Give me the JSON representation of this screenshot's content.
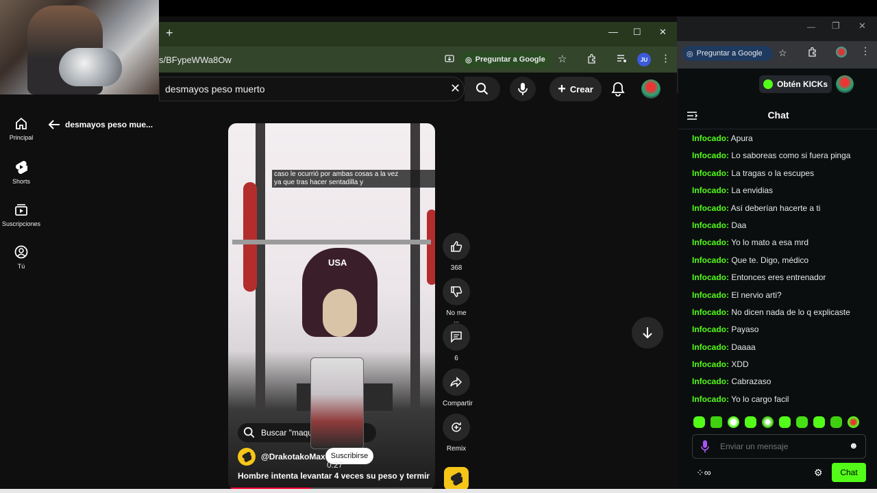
{
  "browser": {
    "new_tab": "+",
    "url": "s/BFypeWWa8Ow",
    "ask_google": "Preguntar a Google",
    "profile_initials": "JU",
    "bg_ask_google": "Preguntar a Google"
  },
  "youtube": {
    "search_value": "desmayos peso muerto",
    "create_label": "Crear",
    "back_title": "desmayos peso mue...",
    "sidebar": [
      {
        "label": "Principal",
        "icon": "home-icon"
      },
      {
        "label": "Shorts",
        "icon": "shorts-icon"
      },
      {
        "label": "Suscripciones",
        "icon": "subscriptions-icon"
      },
      {
        "label": "Tú",
        "icon": "you-icon"
      }
    ],
    "short": {
      "caption_line1": "caso le ocurrió por ambas cosas a la vez",
      "caption_line2": "ya que tras hacer sentadilla y",
      "jersey_text": "USA",
      "search_chip": "Buscar \"maqu",
      "channel": "@DrakotakoMax",
      "subscribe": "Suscribirse",
      "time": "0:27",
      "title": "Hombre intenta levantar 4 veces su peso y termina..."
    },
    "actions": {
      "likes": "368",
      "dislike": "No me ...",
      "comments": "6",
      "share": "Compartir",
      "remix": "Remix"
    }
  },
  "kick": {
    "get_kicks": "Obtén KICKs",
    "chat_title": "Chat",
    "username": "Infocado:",
    "messages": [
      "Apura",
      "Lo saboreas como si fuera pinga",
      "La tragas o la escupes",
      "La envidias",
      "Así deberían hacerte a ti",
      "Daa",
      "Yo lo mato a esa mrd",
      "Que te. Digo, médico",
      "Entonces eres entrenador",
      "El nervio arti?",
      "No dicen nada de lo q explicaste",
      "Payaso",
      "Daaaa",
      "XDD",
      "Cabrazaso",
      "Yo lo cargo facil"
    ],
    "input_placeholder": "Enviar un mensaje",
    "chat_button": "Chat",
    "accent": "#53fc18"
  }
}
